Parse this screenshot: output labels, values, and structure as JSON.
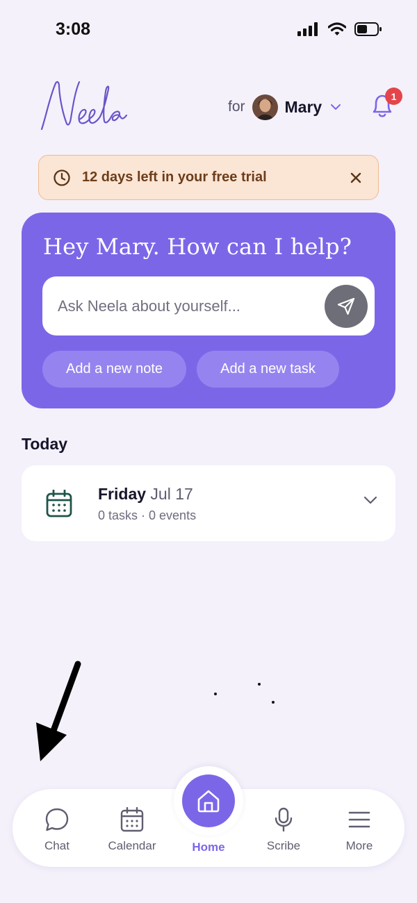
{
  "status_bar": {
    "time": "3:08"
  },
  "header": {
    "logo_text": "Neela",
    "for_label": "for",
    "profile_name": "Mary",
    "notification_count": "1"
  },
  "trial_banner": {
    "text": "12 days left in your free trial"
  },
  "hero": {
    "title": "Hey Mary. How can I help?",
    "ask_placeholder": "Ask Neela about yourself...",
    "chip_note": "Add a new note",
    "chip_task": "Add a new task"
  },
  "today": {
    "heading": "Today",
    "weekday": "Friday",
    "date": "Jul 17",
    "summary": "0 tasks · 0 events"
  },
  "nav": {
    "chat": "Chat",
    "calendar": "Calendar",
    "home": "Home",
    "scribe": "Scribe",
    "more": "More"
  },
  "colors": {
    "accent": "#7c66e8",
    "background": "#f4f1fb",
    "banner_bg": "#fbe5d4",
    "badge": "#e3454b",
    "calendar_icon": "#1f5449"
  },
  "icons": [
    "clock-icon",
    "close-icon",
    "send-icon",
    "calendar-icon",
    "chevron-down-icon",
    "bell-icon",
    "chat-icon",
    "home-icon",
    "microphone-icon",
    "menu-icon",
    "down-left-arrow-annotation"
  ]
}
